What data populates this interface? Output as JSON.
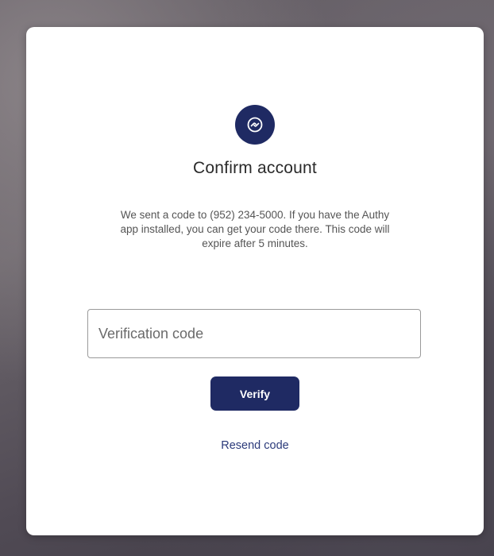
{
  "dialog": {
    "logo_icon": "authy-logo-icon",
    "title": "Confirm account",
    "description": "We sent a code to (952) 234-5000. If you have the Authy app installed, you can get your code there. This code will expire after 5 minutes.",
    "code_input": {
      "placeholder": "Verification code",
      "value": ""
    },
    "verify_label": "Verify",
    "resend_label": "Resend code"
  },
  "colors": {
    "accent": "#1f2a63",
    "link": "#2b3a7a",
    "card": "#ffffff"
  }
}
